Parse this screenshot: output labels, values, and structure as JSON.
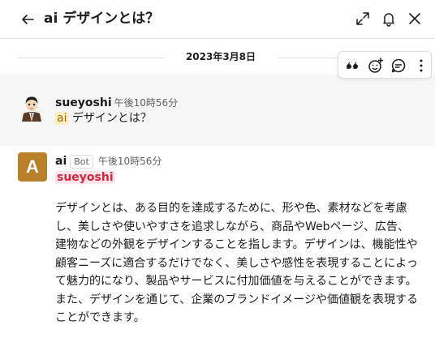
{
  "header": {
    "title": "ai デザインとは？",
    "icons": [
      "back-arrow-icon",
      "expand-icon",
      "bell-icon",
      "close-icon"
    ]
  },
  "date_divider": "2023年3月8日",
  "message_actions": {
    "icons": [
      "quote-icon",
      "add-reaction-icon",
      "reply-in-thread-icon",
      "more-actions-icon"
    ]
  },
  "messages": [
    {
      "author": "sueyoshi",
      "time": "午後10時56分",
      "mention": "ai",
      "text": "デザインとは？"
    },
    {
      "author": "ai",
      "badge": "Bot",
      "time": "午後10時56分",
      "avatar_letter": "A",
      "avatar_color": "#b9802a",
      "mention": "sueyoshi",
      "text": "デザインとは、ある目的を達成するために、形や色、素材などを考慮し、美しさや使いやすさを追求しながら、商品やWebページ、広告、建物などの外観をデザインすることを指します。デザインは、機能性や顧客ニーズに適合するだけでなく、美しさや感性を表現することによって魅力的になり、製品やサービスに付加価値を与えることができます。また、デザインを通じて、企業のブランドイメージや価値観を表現することができます。"
    }
  ]
}
